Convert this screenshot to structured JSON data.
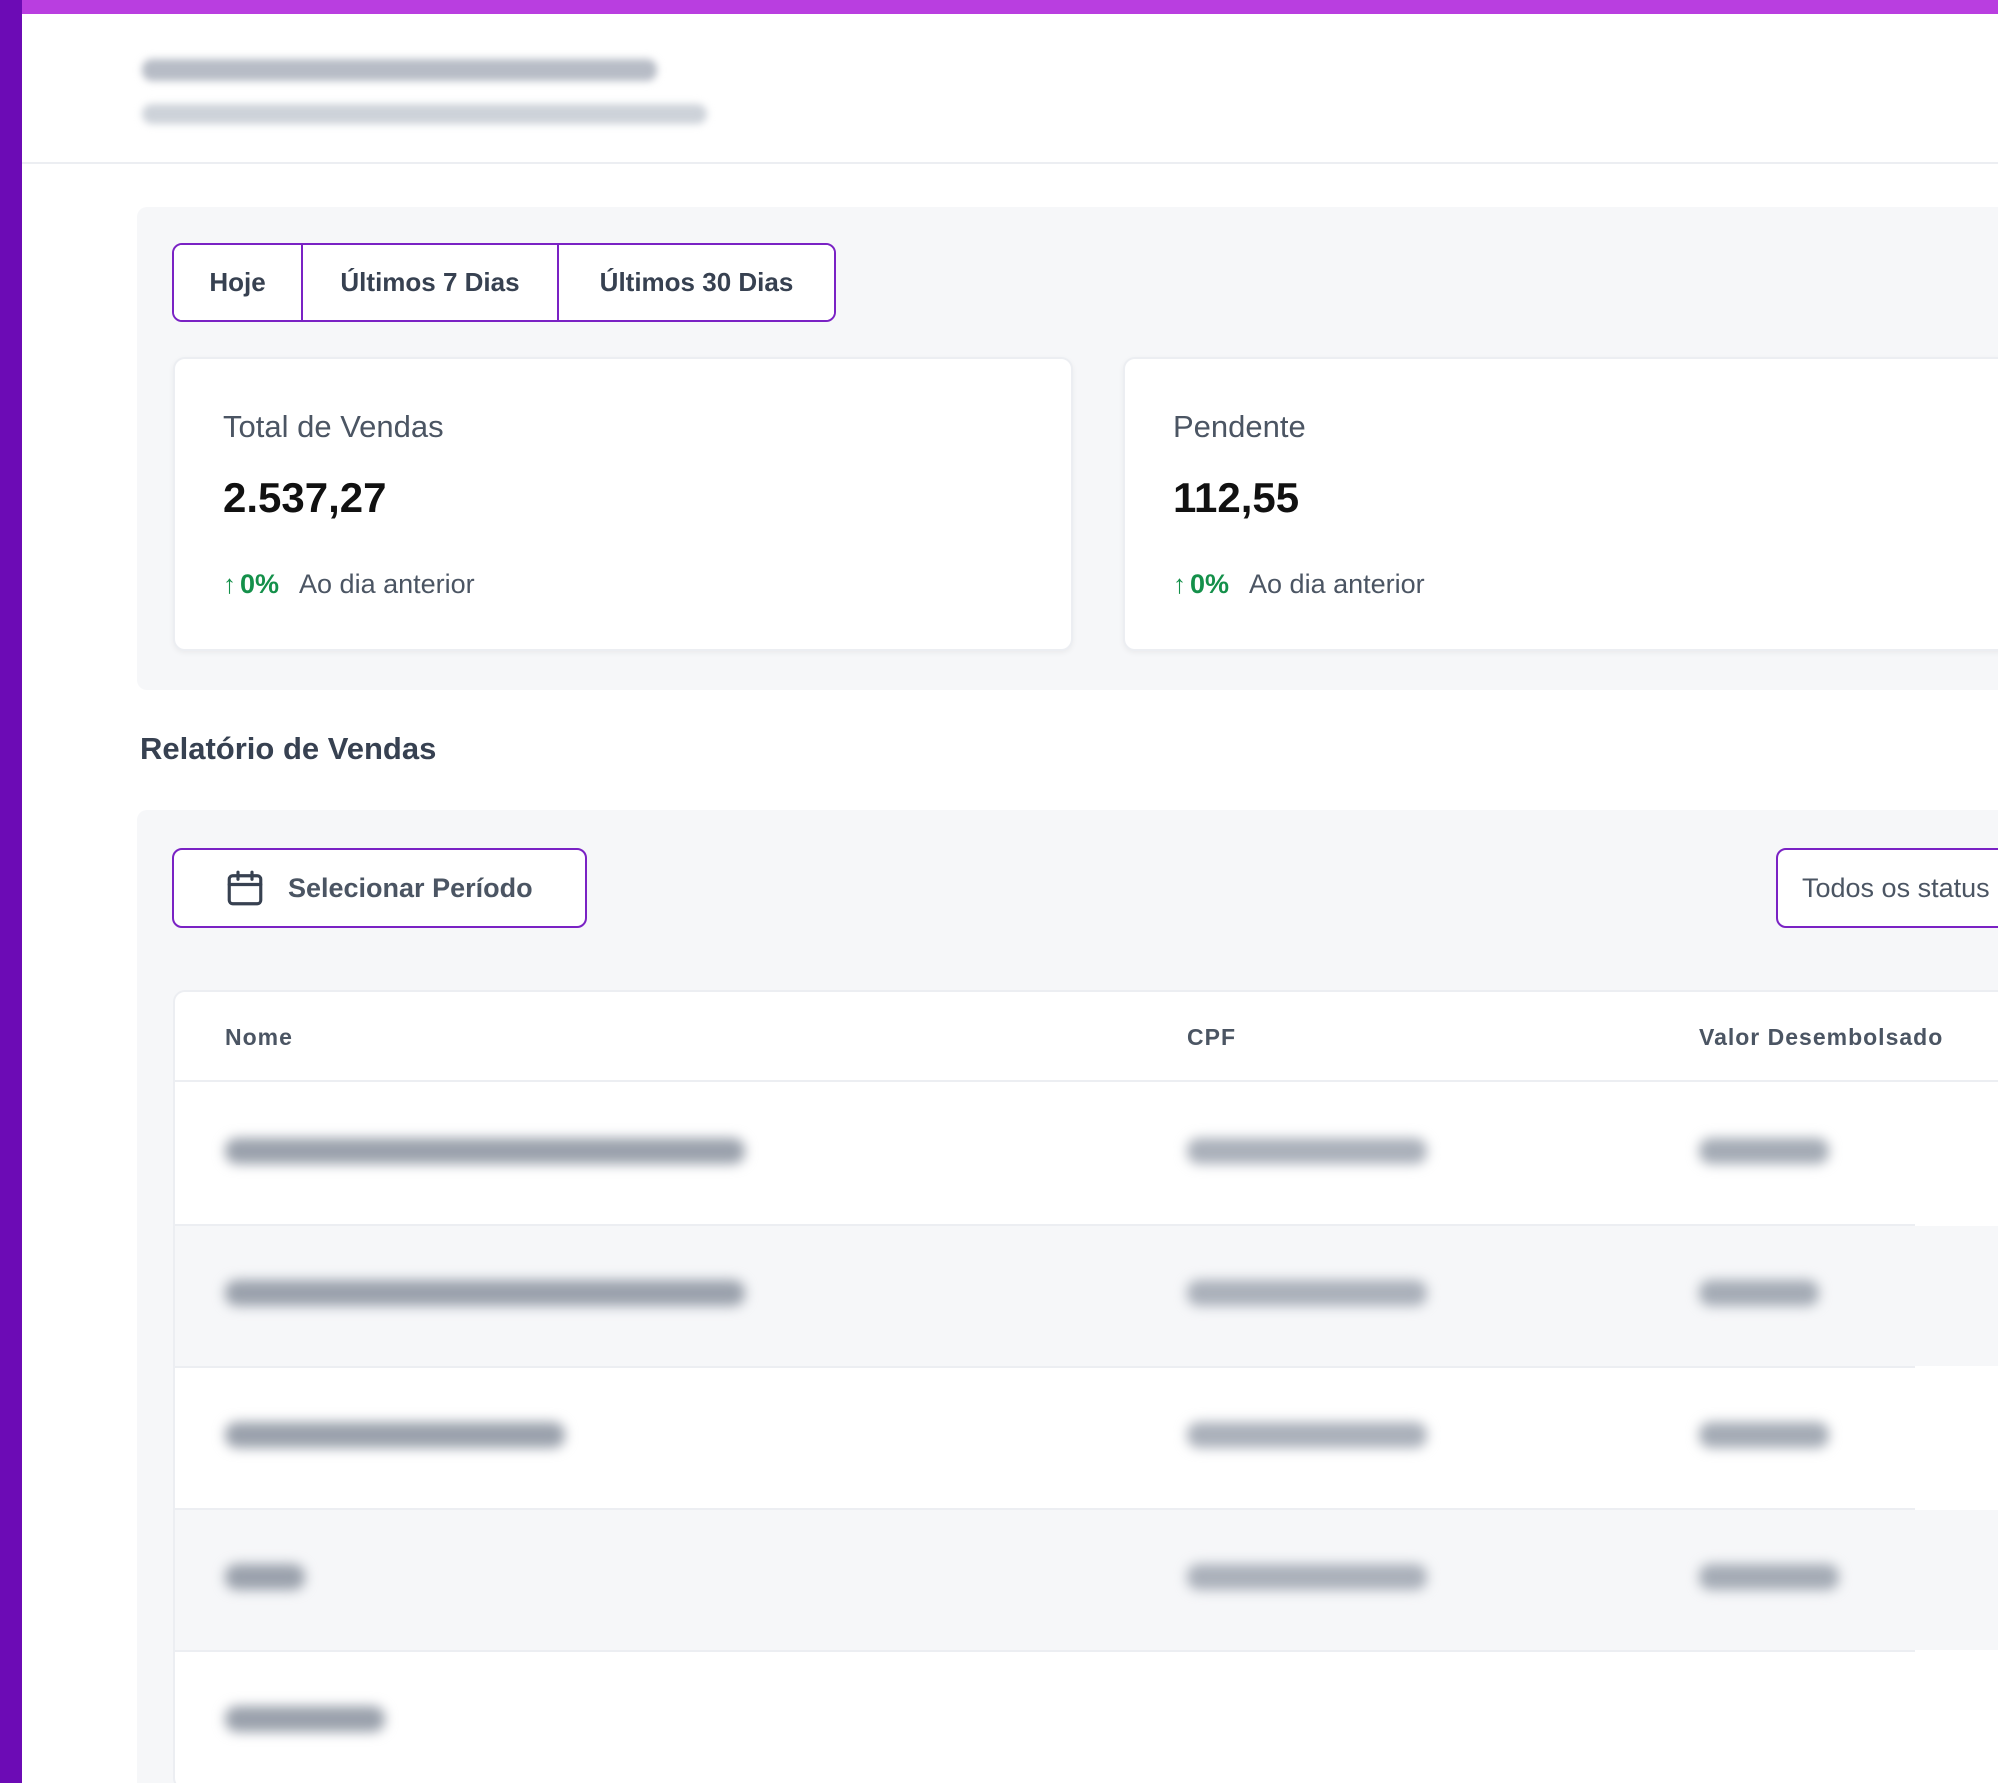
{
  "summary": {
    "period_tabs": [
      {
        "label": "Hoje"
      },
      {
        "label": "Últimos 7 Dias"
      },
      {
        "label": "Últimos 30 Dias"
      }
    ],
    "cards": [
      {
        "label": "Total de Vendas",
        "value": "2.537,27",
        "trend_percent": "0%",
        "trend_label": "Ao dia anterior"
      },
      {
        "label": "Pendente",
        "value": "112,55",
        "trend_percent": "0%",
        "trend_label": "Ao dia anterior"
      }
    ],
    "trend_arrow": "↑",
    "trend_color": "#14904a"
  },
  "report": {
    "title": "Relatório de Vendas",
    "period_button_label": "Selecionar Período",
    "status_filter_value": "Todos os status",
    "columns": [
      "Nome",
      "CPF",
      "Valor Desembolsado"
    ]
  },
  "colors": {
    "sidebar": "#6c0bb5",
    "top_line": "#b93ee0",
    "accent": "#7a22c4"
  }
}
